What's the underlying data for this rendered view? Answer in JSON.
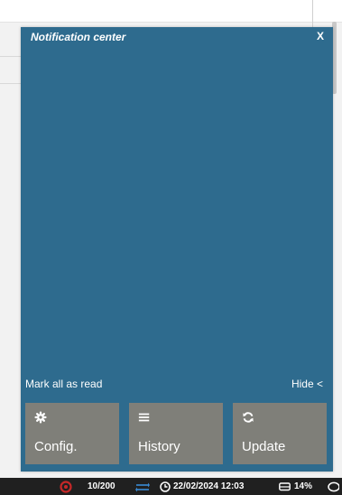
{
  "panel": {
    "title": "Notification center",
    "close_label": "X",
    "mark_all_read": "Mark all as read",
    "hide_label": "Hide <",
    "buttons": [
      {
        "label": "Config.",
        "icon": "gear-icon"
      },
      {
        "label": "History",
        "icon": "list-icon"
      },
      {
        "label": "Update",
        "icon": "refresh-icon"
      }
    ],
    "notifications": []
  },
  "statusbar": {
    "counter": "10/200",
    "datetime": "22/02/2024 12:03",
    "disk_percent": "14%"
  },
  "colors": {
    "panel_bg": "#2e6b8e",
    "button_bg": "#7f7f79",
    "statusbar_bg": "#202020",
    "alert": "#c62828",
    "sync": "#3a8bd6"
  }
}
